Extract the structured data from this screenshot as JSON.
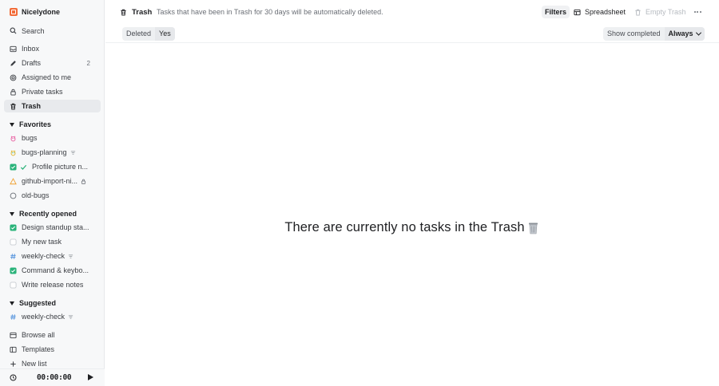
{
  "workspace": {
    "name": "Nicelydone",
    "logo_color": "#f26b38"
  },
  "search": {
    "label": "Search"
  },
  "nav": [
    {
      "label": "Inbox",
      "icon": "inbox-icon"
    },
    {
      "label": "Drafts",
      "icon": "pencil-icon",
      "count": "2"
    },
    {
      "label": "Assigned to me",
      "icon": "target-icon"
    },
    {
      "label": "Private tasks",
      "icon": "lock-icon"
    },
    {
      "label": "Trash",
      "icon": "trash-icon",
      "active": true
    }
  ],
  "favorites": {
    "title": "Favorites",
    "items": [
      {
        "label": "bugs",
        "icon": "bug-icon"
      },
      {
        "label": "bugs-planning",
        "icon": "bug-icon"
      },
      {
        "label": "Profile picture n...",
        "icon": "checkbox-checked-icon"
      },
      {
        "label": "github-import-ni...",
        "icon": "warning-icon"
      },
      {
        "label": "old-bugs",
        "icon": "circle-icon"
      }
    ]
  },
  "recent": {
    "title": "Recently opened",
    "items": [
      {
        "label": "Design standup sta...",
        "icon": "checkbox-checked-icon"
      },
      {
        "label": "My new task",
        "icon": "checkbox-empty-icon"
      },
      {
        "label": "weekly-check",
        "icon": "hash-icon"
      },
      {
        "label": "Command & keybo...",
        "icon": "checkbox-checked-icon"
      },
      {
        "label": "Write release notes",
        "icon": "checkbox-empty-icon"
      }
    ]
  },
  "suggested": {
    "title": "Suggested",
    "items": [
      {
        "label": "weekly-check",
        "icon": "hash-icon"
      }
    ]
  },
  "footer_links": [
    {
      "label": "Browse all",
      "icon": "grid-icon"
    },
    {
      "label": "Templates",
      "icon": "template-icon"
    },
    {
      "label": "New list",
      "icon": "plus-icon"
    }
  ],
  "timer": {
    "time": "00:00:00"
  },
  "header": {
    "title": "Trash",
    "description": "Tasks that have been in Trash for 30 days will be automatically deleted.",
    "filters_label": "Filters",
    "spreadsheet_label": "Spreadsheet",
    "empty_trash_label": "Empty Trash"
  },
  "filter_pill": {
    "key": "Deleted",
    "value": "Yes"
  },
  "show_completed": {
    "label": "Show completed",
    "value": "Always"
  },
  "empty_state": {
    "message": "There are currently no tasks in the Trash"
  },
  "colors": {
    "accent_green": "#2ab37a",
    "bug_pink": "#e85a9e",
    "bug_yellow": "#e0b32a",
    "warning_orange": "#f0a030",
    "hash_blue": "#4a8ddb"
  }
}
